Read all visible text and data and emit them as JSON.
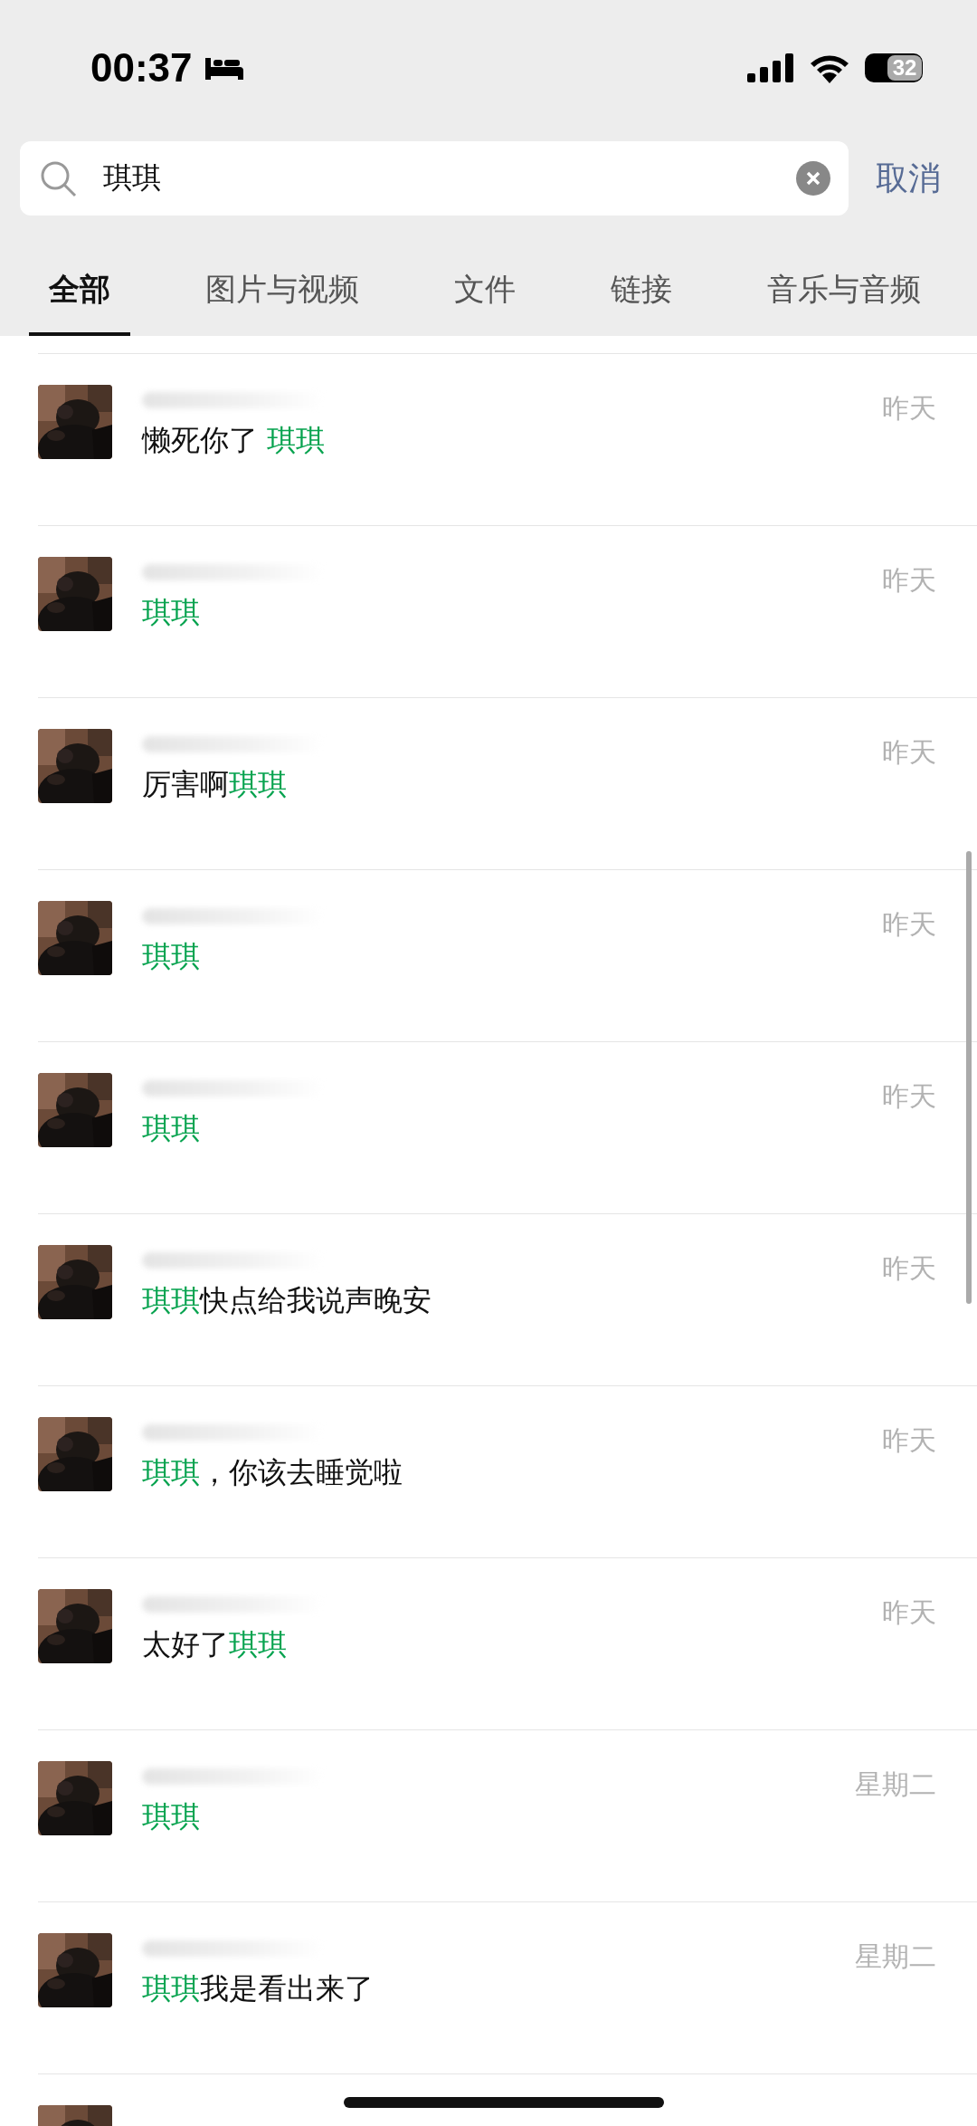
{
  "status_bar": {
    "time": "00:37",
    "battery": "32"
  },
  "search": {
    "value": "琪琪",
    "cancel": "取消"
  },
  "tabs": [
    {
      "label": "全部",
      "selected": true
    },
    {
      "label": "图片与视频",
      "selected": false
    },
    {
      "label": "文件",
      "selected": false
    },
    {
      "label": "链接",
      "selected": false
    },
    {
      "label": "音乐与音频",
      "selected": false
    }
  ],
  "results": [
    {
      "time": "昨天",
      "message": [
        {
          "text": "懒死你了 ",
          "highlight": false
        },
        {
          "text": "琪琪",
          "highlight": true
        }
      ]
    },
    {
      "time": "昨天",
      "message": [
        {
          "text": "琪琪",
          "highlight": true
        }
      ]
    },
    {
      "time": "昨天",
      "message": [
        {
          "text": "厉害啊",
          "highlight": false
        },
        {
          "text": "琪琪",
          "highlight": true
        }
      ]
    },
    {
      "time": "昨天",
      "message": [
        {
          "text": "琪琪",
          "highlight": true
        }
      ]
    },
    {
      "time": "昨天",
      "message": [
        {
          "text": "琪琪",
          "highlight": true
        }
      ]
    },
    {
      "time": "昨天",
      "message": [
        {
          "text": "琪琪",
          "highlight": true
        },
        {
          "text": "快点给我说声晚安",
          "highlight": false
        }
      ]
    },
    {
      "time": "昨天",
      "message": [
        {
          "text": "琪琪",
          "highlight": true
        },
        {
          "text": "，你该去睡觉啦",
          "highlight": false
        }
      ]
    },
    {
      "time": "昨天",
      "message": [
        {
          "text": "太好了",
          "highlight": false
        },
        {
          "text": "琪琪",
          "highlight": true
        }
      ]
    },
    {
      "time": "星期二",
      "message": [
        {
          "text": "琪琪",
          "highlight": true
        }
      ]
    },
    {
      "time": "星期二",
      "message": [
        {
          "text": "琪琪",
          "highlight": true
        },
        {
          "text": "我是看出来了",
          "highlight": false
        }
      ]
    }
  ]
}
